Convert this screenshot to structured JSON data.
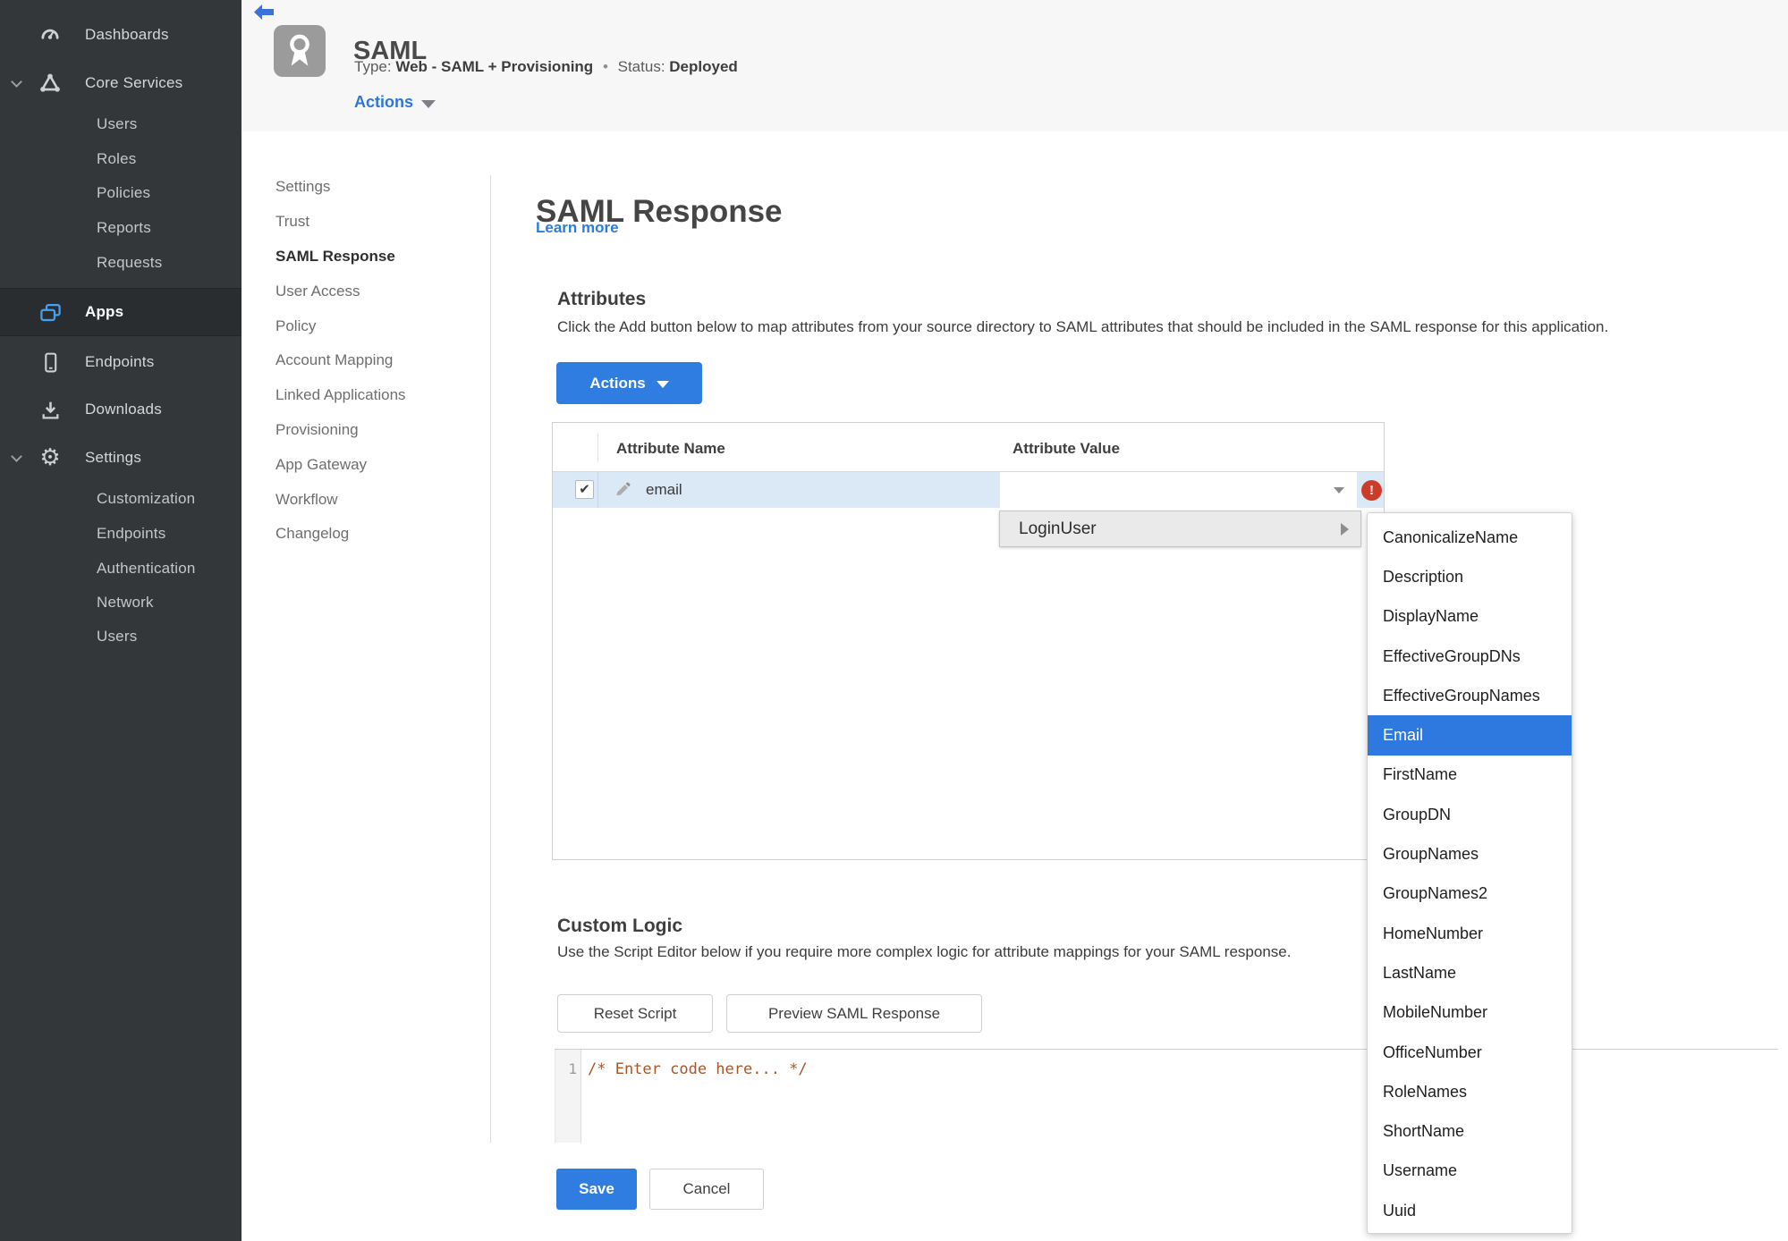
{
  "colors": {
    "accent_blue": "#2F7DE1",
    "link_blue": "#2B7CE0",
    "status_green": "#3E8E28",
    "error_red": "#CC3C2A",
    "selection_blue": "#2D79E0",
    "sidebar_bg": "#34373A",
    "selected_row_bg": "#DBE8F6"
  },
  "sidebar": {
    "dashboards": "Dashboards",
    "core_services": "Core Services",
    "core_children": {
      "users": "Users",
      "roles": "Roles",
      "policies": "Policies",
      "reports": "Reports",
      "requests": "Requests"
    },
    "apps": "Apps",
    "endpoints": "Endpoints",
    "downloads": "Downloads",
    "settings": "Settings",
    "settings_children": {
      "customization": "Customization",
      "endpoints": "Endpoints",
      "authentication": "Authentication",
      "network": "Network",
      "users": "Users"
    }
  },
  "header": {
    "title": "SAML",
    "type_label": "Type:",
    "type_value": "Web - SAML + Provisioning",
    "dot": "•",
    "status_label": "Status:",
    "status_value": "Deployed",
    "actions": "Actions"
  },
  "subnav": {
    "items": [
      "Settings",
      "Trust",
      "SAML Response",
      "User Access",
      "Policy",
      "Account Mapping",
      "Linked Applications",
      "Provisioning",
      "App Gateway",
      "Workflow",
      "Changelog"
    ]
  },
  "main": {
    "title": "SAML Response",
    "learn_more": "Learn more",
    "attributes": {
      "heading": "Attributes",
      "description": "Click the Add button below to map attributes from your source directory to SAML attributes that should be included in the SAML response for this application.",
      "actions_button": "Actions",
      "table": {
        "col_name": "Attribute Name",
        "col_value": "Attribute Value",
        "row": {
          "name": "email",
          "checked": "✔",
          "value": "",
          "error": "!"
        }
      }
    },
    "menu": {
      "parent": "LoginUser",
      "items": [
        "CanonicalizeName",
        "Description",
        "DisplayName",
        "EffectiveGroupDNs",
        "EffectiveGroupNames",
        "Email",
        "FirstName",
        "GroupDN",
        "GroupNames",
        "GroupNames2",
        "HomeNumber",
        "LastName",
        "MobileNumber",
        "OfficeNumber",
        "RoleNames",
        "ShortName",
        "Username",
        "Uuid"
      ],
      "selected": "Email"
    },
    "custom_logic": {
      "heading": "Custom Logic",
      "description": "Use the Script Editor below if you require more complex logic for attribute mappings for your SAML response.",
      "reset_button": "Reset Script",
      "preview_button": "Preview SAML Response",
      "line_number": "1",
      "code": "/* Enter code here... */"
    },
    "footer": {
      "save": "Save",
      "cancel": "Cancel"
    }
  }
}
